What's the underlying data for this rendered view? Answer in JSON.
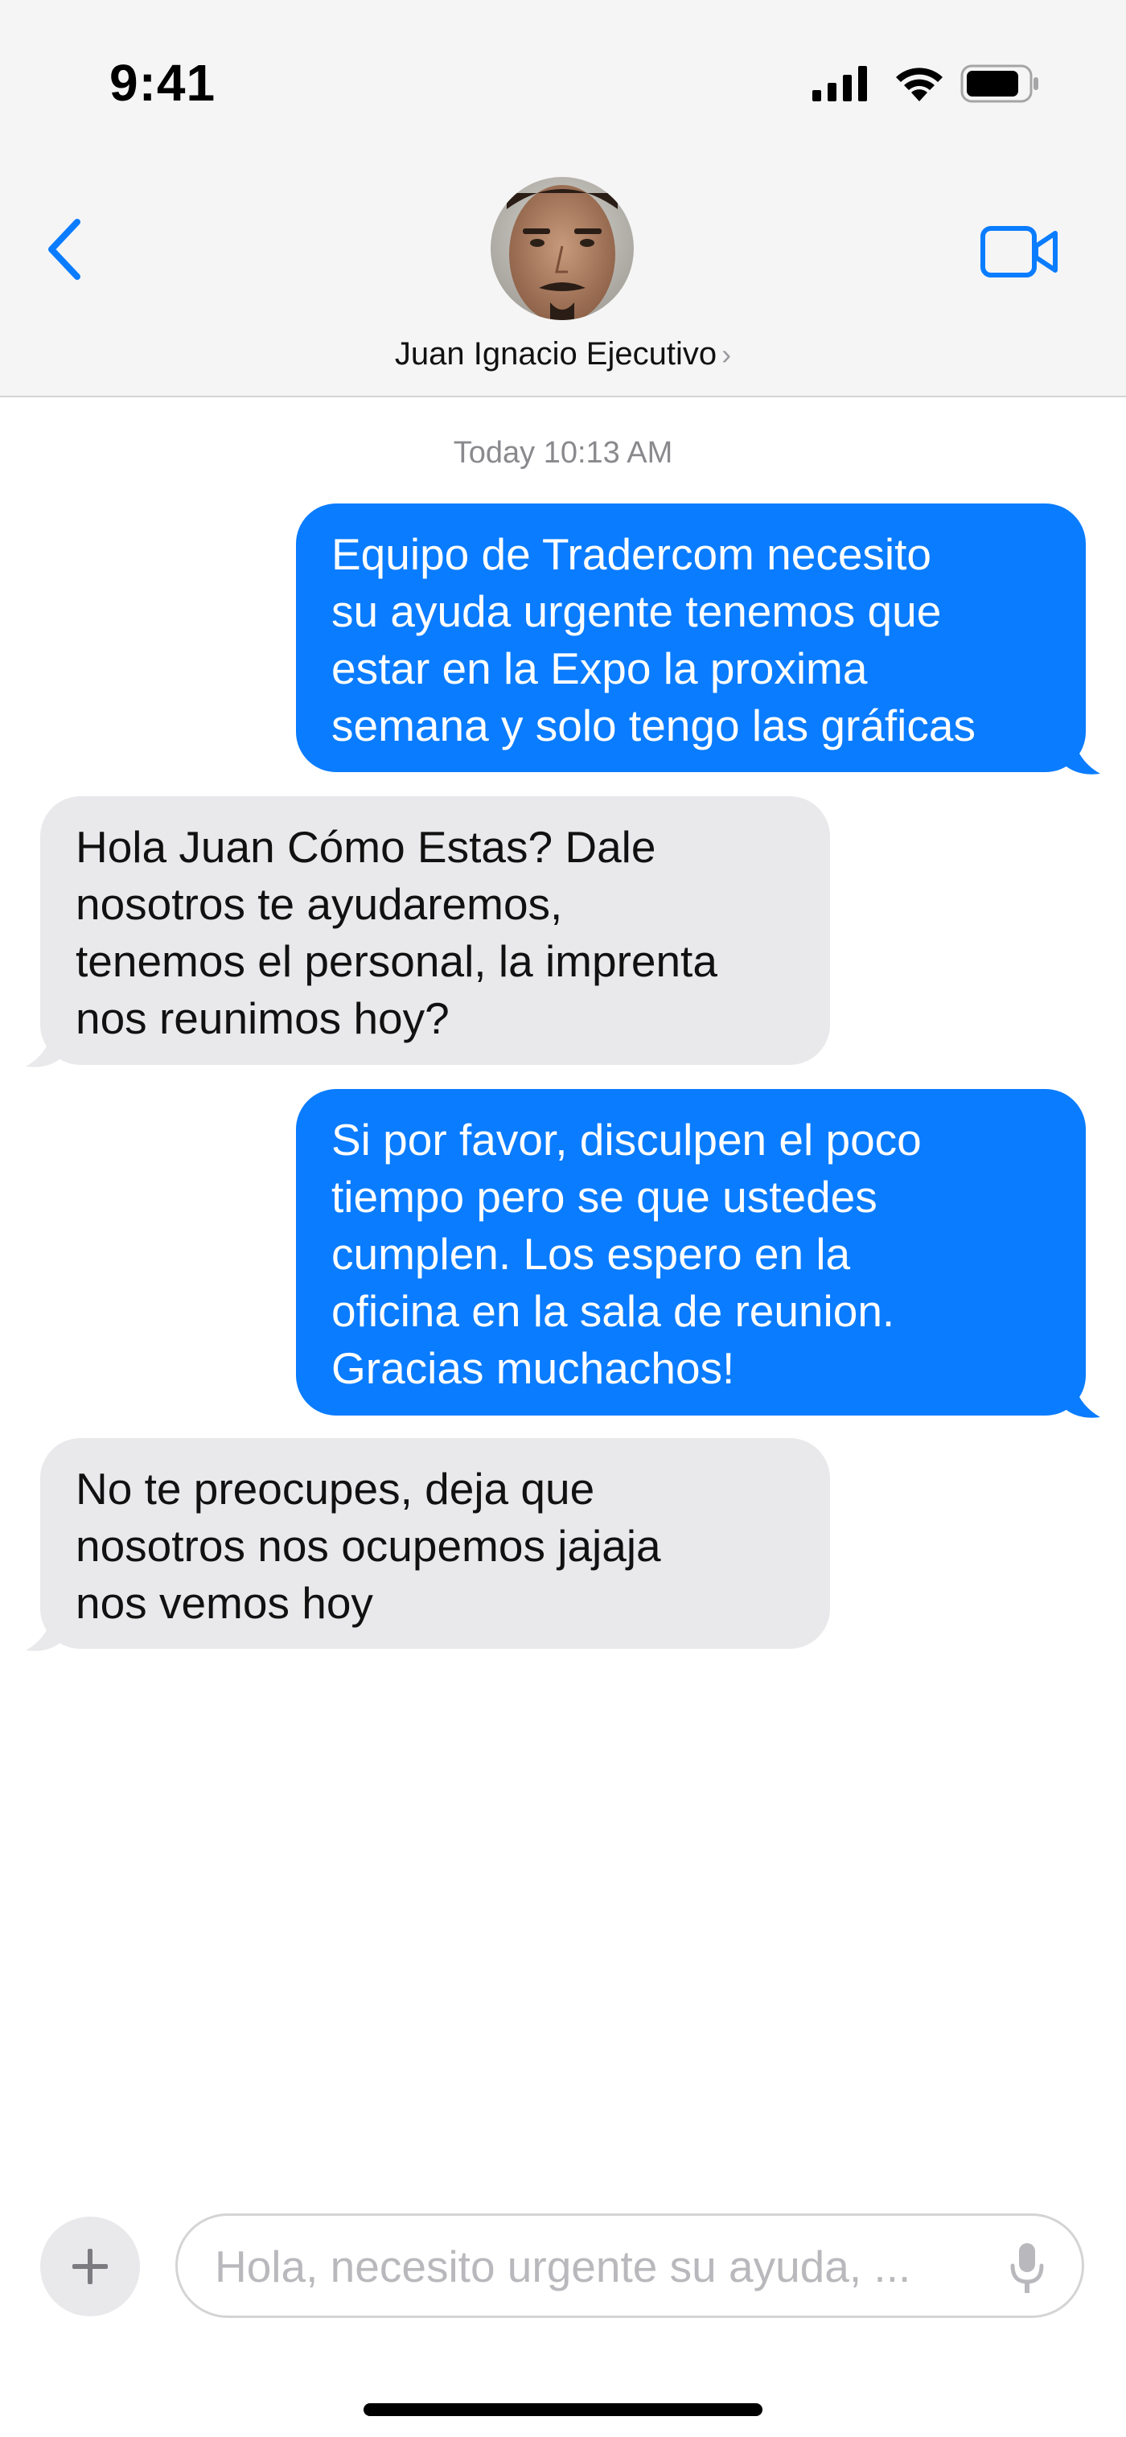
{
  "status_bar": {
    "time": "9:41",
    "icons": [
      "cellular-signal-icon",
      "wifi-icon",
      "battery-icon"
    ]
  },
  "header": {
    "contact_name": "Juan Ignacio Ejecutivo",
    "chevron": "›",
    "icons": [
      "back-chevron-icon",
      "video-call-icon"
    ],
    "avatar": "contact-avatar"
  },
  "conversation": {
    "timestamp": "Today 10:13 AM",
    "messages": [
      {
        "direction": "outgoing",
        "lines": [
          "Equipo de Tradercom necesito",
          "su ayuda urgente tenemos que",
          "estar en la Expo la proxima",
          "semana y solo tengo las gráficas"
        ]
      },
      {
        "direction": "incoming",
        "lines": [
          "Hola Juan Cómo Estas? Dale",
          "nosotros te ayudaremos,",
          "tenemos el personal, la imprenta",
          "nos reunimos hoy?"
        ]
      },
      {
        "direction": "outgoing",
        "lines": [
          "Si por favor, disculpen el poco",
          "tiempo pero se que ustedes",
          "cumplen. Los espero en la",
          "oficina en la sala de reunion.",
          "Gracias muchachos!"
        ]
      },
      {
        "direction": "incoming",
        "lines": [
          "No te preocupes, deja que",
          "nosotros nos ocupemos jajaja",
          "nos vemos hoy"
        ]
      }
    ]
  },
  "composer": {
    "placeholder": "Hola, necesito urgente su ayuda, ...",
    "value": "",
    "icons": [
      "plus-icon",
      "microphone-icon"
    ]
  },
  "colors": {
    "outgoing_bubble": "#0a7cff",
    "incoming_bubble": "#e9e9eb",
    "accent": "#0a7cff",
    "header_bg": "#f5f5f5"
  }
}
